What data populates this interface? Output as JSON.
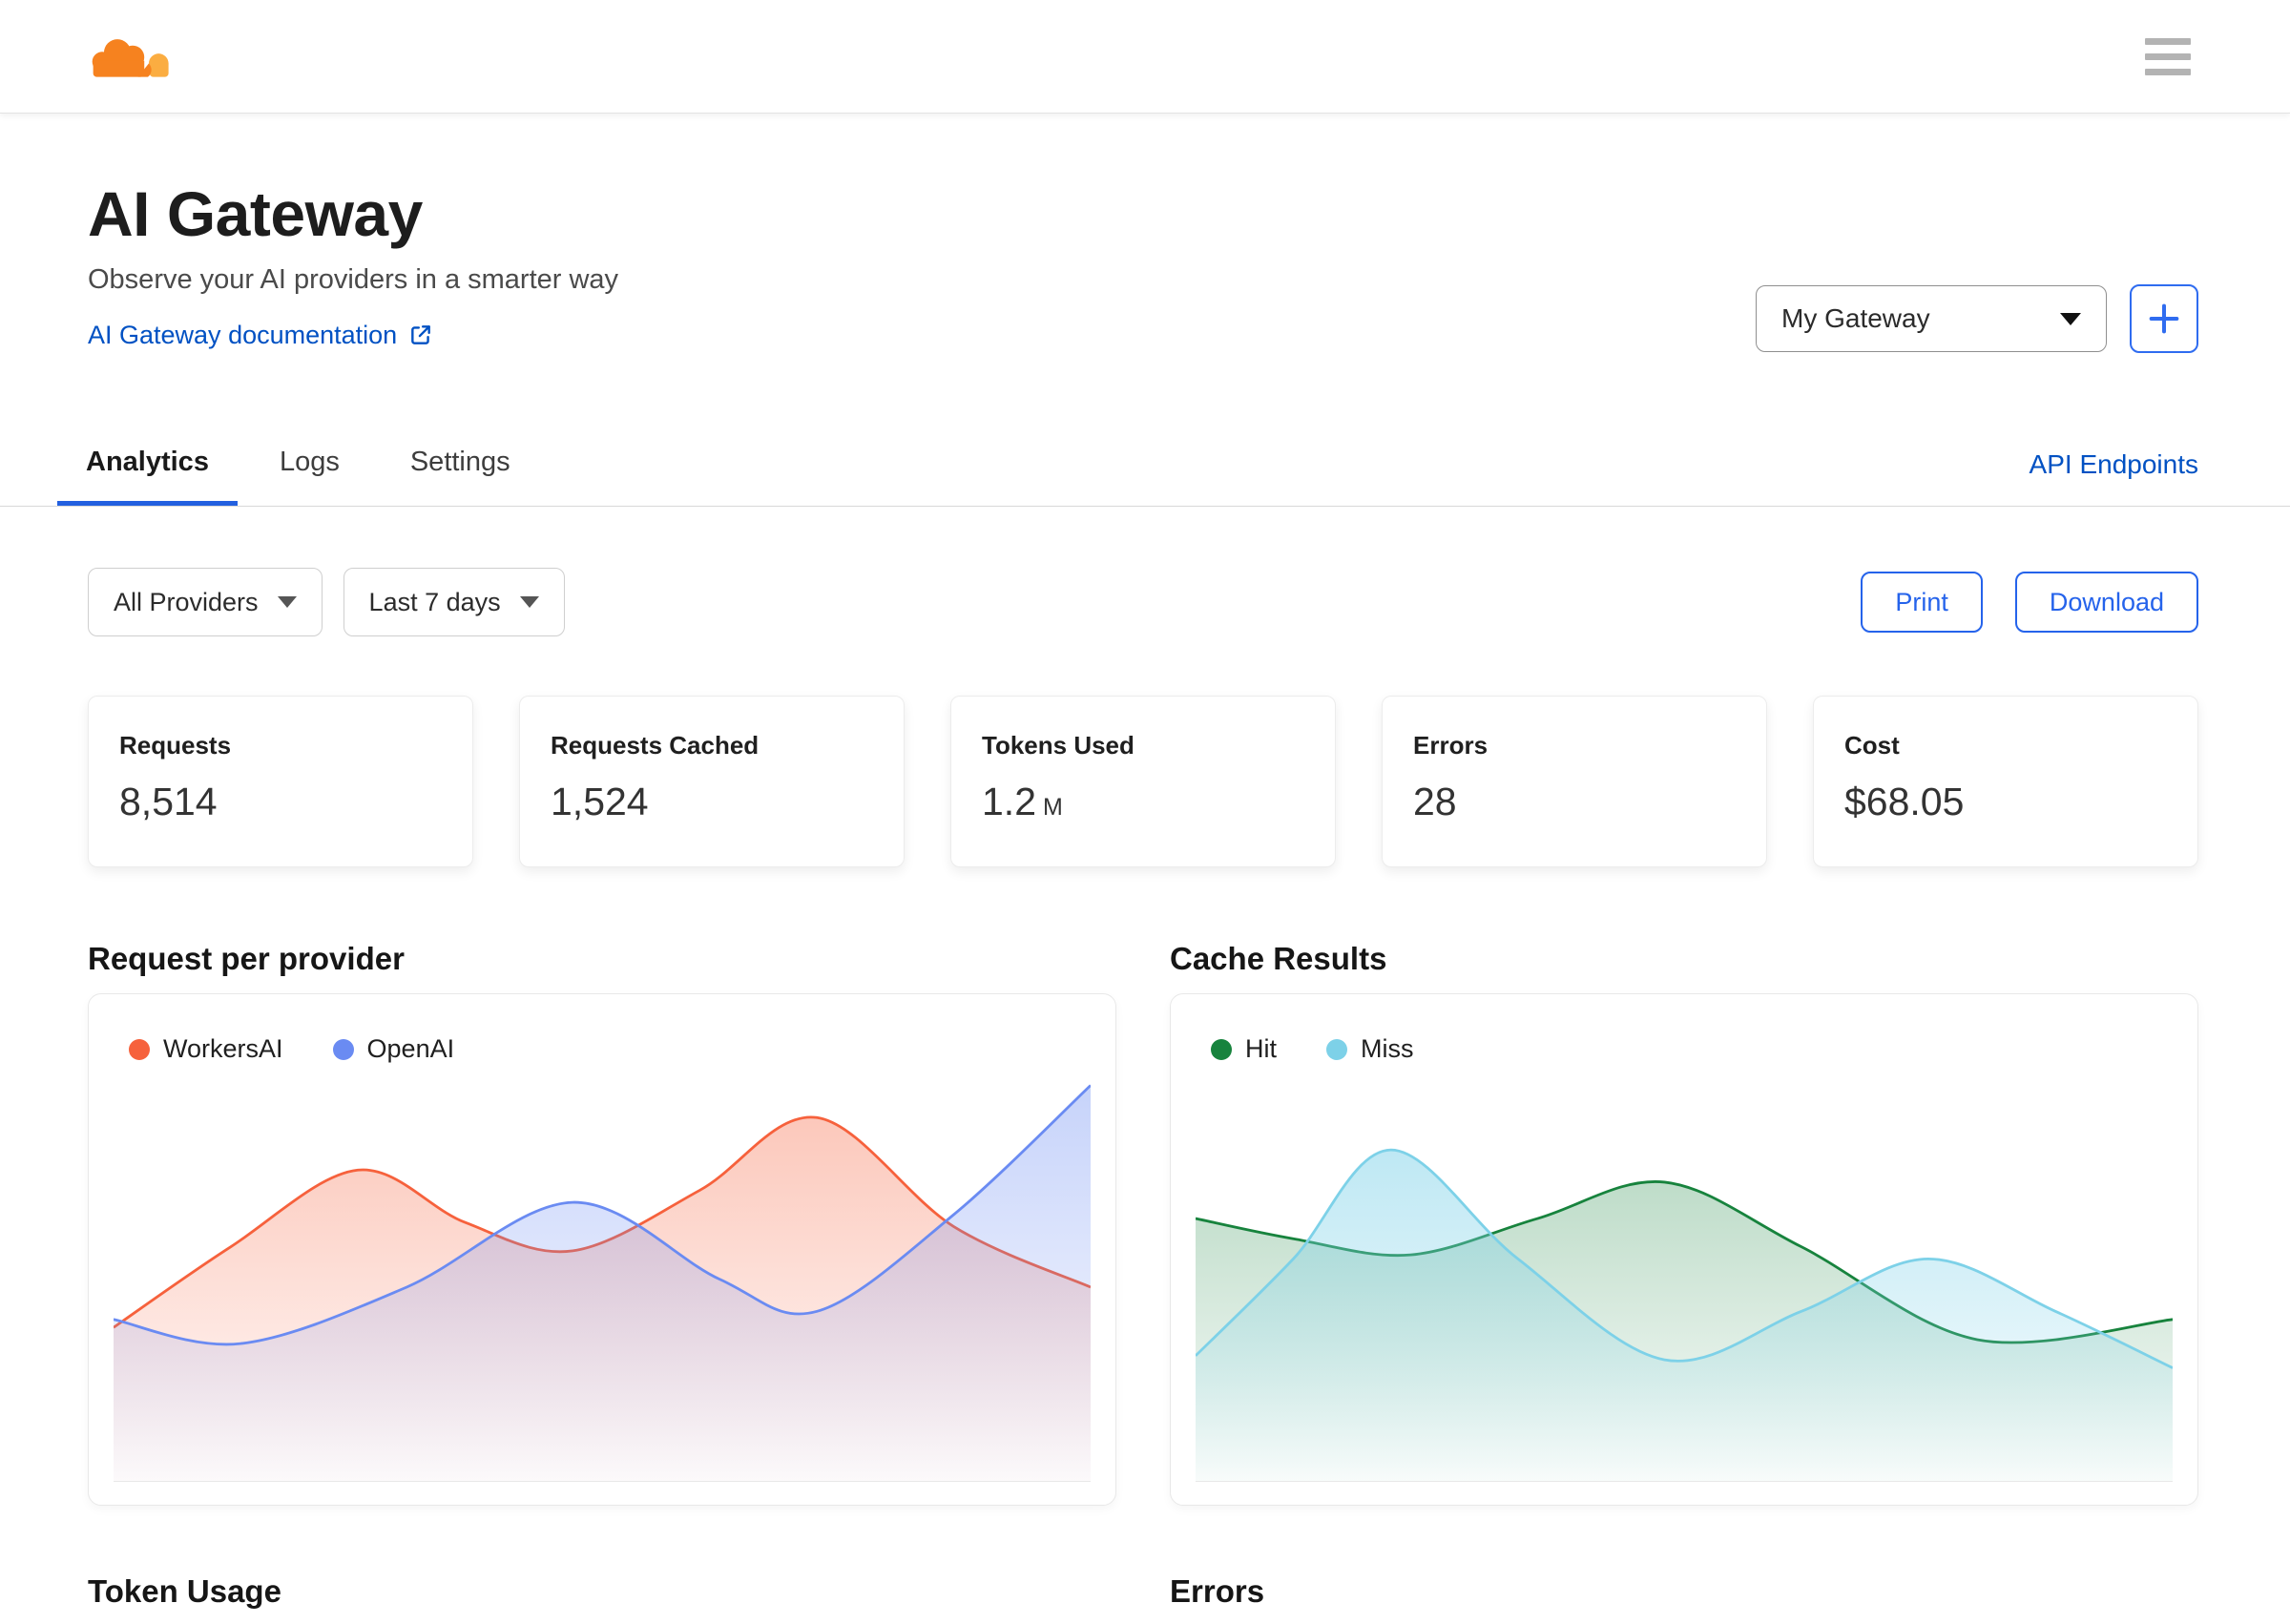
{
  "theme": {
    "link_blue": "#0051c3",
    "action_blue": "#2563eb",
    "tab_underline": "#2360e0",
    "logo_orange": "#f6821f",
    "logo_light_orange": "#fbad41"
  },
  "topbar": {
    "logo": "cloudflare-cloud-logo",
    "menu_icon": "hamburger-menu"
  },
  "page": {
    "title": "AI Gateway",
    "subtitle": "Observe your AI providers in a smarter way",
    "doc_link_label": "AI Gateway documentation",
    "gateway_selector_value": "My Gateway",
    "add_gateway_icon": "plus"
  },
  "tabs": {
    "items": [
      {
        "label": "Analytics",
        "active": true
      },
      {
        "label": "Logs",
        "active": false
      },
      {
        "label": "Settings",
        "active": false
      }
    ],
    "right_link": "API Endpoints"
  },
  "filters": {
    "provider_select_value": "All Providers",
    "range_select_value": "Last 7 days",
    "print_label": "Print",
    "download_label": "Download"
  },
  "stats": [
    {
      "label": "Requests",
      "value": "8,514"
    },
    {
      "label": "Requests Cached",
      "value": "1,524"
    },
    {
      "label": "Tokens Used",
      "value": "1.2",
      "unit": "M"
    },
    {
      "label": "Errors",
      "value": "28"
    },
    {
      "label": "Cost",
      "value": "$68.05"
    }
  ],
  "charts": [
    {
      "title": "Request per provider",
      "type": "area",
      "axes": {
        "x_ticks_visible": false,
        "y_ticks_visible": false,
        "baseline": true
      },
      "legend_position": "top-left",
      "series": [
        {
          "name": "WorkersAI",
          "color": "#F6613C",
          "fill_top_opacity": 0.35,
          "points": [
            {
              "x": 0.0,
              "y": 38
            },
            {
              "x": 0.12,
              "y": 58
            },
            {
              "x": 0.25,
              "y": 77
            },
            {
              "x": 0.36,
              "y": 64
            },
            {
              "x": 0.47,
              "y": 57
            },
            {
              "x": 0.6,
              "y": 72
            },
            {
              "x": 0.72,
              "y": 90
            },
            {
              "x": 0.86,
              "y": 63
            },
            {
              "x": 1.0,
              "y": 48
            }
          ]
        },
        {
          "name": "OpenAI",
          "color": "#6A8BF2",
          "fill_top_opacity": 0.38,
          "points": [
            {
              "x": 0.0,
              "y": 40
            },
            {
              "x": 0.13,
              "y": 34
            },
            {
              "x": 0.3,
              "y": 48
            },
            {
              "x": 0.47,
              "y": 69
            },
            {
              "x": 0.62,
              "y": 50
            },
            {
              "x": 0.72,
              "y": 42
            },
            {
              "x": 0.86,
              "y": 66
            },
            {
              "x": 1.0,
              "y": 98
            }
          ]
        }
      ]
    },
    {
      "title": "Cache Results",
      "type": "area",
      "axes": {
        "x_ticks_visible": false,
        "y_ticks_visible": false,
        "baseline": true
      },
      "legend_position": "top-left",
      "series": [
        {
          "name": "Hit",
          "color": "#17833D",
          "fill_top_opacity": 0.28,
          "points": [
            {
              "x": 0.0,
              "y": 65
            },
            {
              "x": 0.1,
              "y": 60
            },
            {
              "x": 0.22,
              "y": 56
            },
            {
              "x": 0.35,
              "y": 65
            },
            {
              "x": 0.48,
              "y": 74
            },
            {
              "x": 0.62,
              "y": 58
            },
            {
              "x": 0.8,
              "y": 35
            },
            {
              "x": 1.0,
              "y": 40
            }
          ]
        },
        {
          "name": "Miss",
          "color": "#7DD1E8",
          "fill_top_opacity": 0.5,
          "points": [
            {
              "x": 0.0,
              "y": 31
            },
            {
              "x": 0.1,
              "y": 55
            },
            {
              "x": 0.2,
              "y": 82
            },
            {
              "x": 0.33,
              "y": 55
            },
            {
              "x": 0.48,
              "y": 30
            },
            {
              "x": 0.62,
              "y": 42
            },
            {
              "x": 0.75,
              "y": 55
            },
            {
              "x": 0.88,
              "y": 42
            },
            {
              "x": 1.0,
              "y": 28
            }
          ]
        }
      ]
    }
  ],
  "bottom_sections": [
    {
      "title": "Token Usage"
    },
    {
      "title": "Errors"
    }
  ]
}
